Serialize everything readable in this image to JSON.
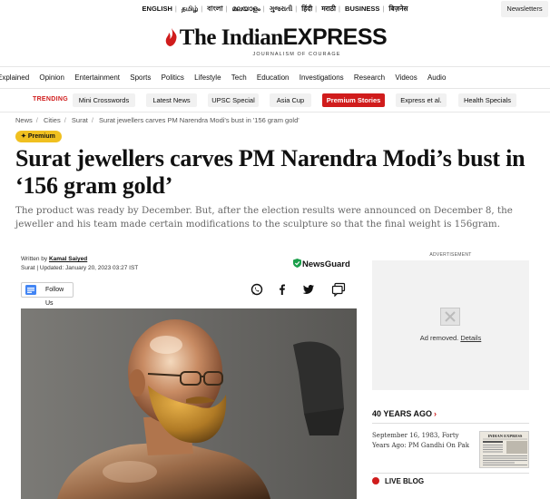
{
  "top_bar": {
    "languages": [
      "ENGLISH",
      "தமிழ்",
      "বাংলা",
      "മലയാളം",
      "ગુજરાતી",
      "हिंदी",
      "मराठी",
      "BUSINESS",
      "बिज़नेस"
    ],
    "newsletters_label": "Newsletters"
  },
  "masthead": {
    "brand_part1": "The Indian",
    "brand_part2": "EXPRESS",
    "tagline": "JOURNALISM OF COURAGE"
  },
  "nav": {
    "items": [
      "Explained",
      "Opinion",
      "Entertainment",
      "Sports",
      "Politics",
      "Lifestyle",
      "Tech",
      "Education",
      "Investigations",
      "Research",
      "Videos",
      "Audio"
    ]
  },
  "trending": {
    "label": "TRENDING",
    "chips": [
      "Mini Crosswords",
      "Latest News",
      "UPSC Special",
      "Asia Cup",
      "Premium Stories",
      "Express et al.",
      "Health Specials"
    ],
    "highlighted_chip": "Premium Stories"
  },
  "breadcrumb": [
    "News",
    "Cities",
    "Surat",
    "Surat jewellers carves PM Narendra Modi's bust in '156 gram gold'"
  ],
  "article": {
    "badge": "Premium",
    "headline": "Surat jewellers carves PM Narendra Modi’s bust in ‘156 gram gold’",
    "standfirst": "The product was ready by December. But, after the election results were announced on December 8, the jeweller and his team made certain modifications to the sculpture so that the final weight is 156gram.",
    "byline_prefix": "Written by",
    "author": "Kamal Saiyed",
    "dateline": "Surat | Updated: January 20, 2023 03:27 IST",
    "newsguard": "NewsGuard",
    "follow_label": "Follow Us"
  },
  "sidebar": {
    "ad_label": "ADVERTISEMENT",
    "ad_removed_text": "Ad removed.",
    "ad_details_link": "Details",
    "years_heading": "40 YEARS AGO",
    "years_story": "September 16, 1983, Forty Years Ago: PM Gandhi On Pak",
    "years_thumb_title": "INDIAN EXPRESS",
    "live_blog": "LIVE BLOG"
  },
  "colors": {
    "accent_red": "#d01c1c",
    "premium_yellow": "#f0c020",
    "newsguard_green": "#1a9f4a"
  }
}
